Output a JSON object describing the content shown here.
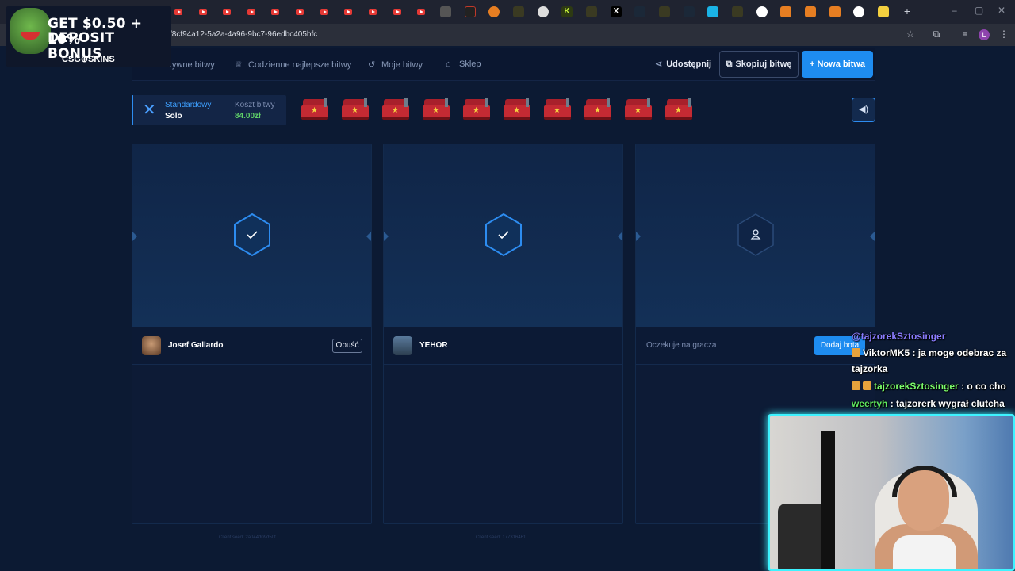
{
  "browser": {
    "url": "/8cf94a12-5a2a-4a96-9bc7-96edbc405bfc",
    "profile_initial": "L"
  },
  "ad": {
    "line1": "GET $0.50 + 10%",
    "line2": "DEPOSIT BONUS",
    "brand": "CSG⊕SKINS"
  },
  "nav": {
    "active_battles": "Aktywne bitwy",
    "daily_best": "Codzienne najlepsze bitwy",
    "my_battles": "Moje bitwy",
    "shop": "Sklep",
    "share": "Udostępnij",
    "copy_battle": "Skopiuj bitwę",
    "new_battle": "+ Nowa bitwa"
  },
  "battle": {
    "mode_label": "Standardowy",
    "mode_value": "Solo",
    "cost_label": "Koszt bitwy",
    "cost_value": "84.00zł",
    "case_count": 10
  },
  "slots": [
    {
      "player": "Josef Gallardo",
      "action": "Opuść",
      "seed": "Client seed: 2a044d09d50f"
    },
    {
      "player": "YEHOR",
      "seed": "Client seed: 177316461"
    },
    {
      "waiting": "Oczekuje na gracza",
      "action": "Dodaj bota"
    }
  ],
  "chat": [
    {
      "user": "@tajzorekSztosinger",
      "user_color": "#8a7cff",
      "text": ""
    },
    {
      "user": "ViktorMK5",
      "user_color": "#ffffff",
      "text": " : ja moge odebrac za"
    },
    {
      "user": "",
      "user_color": "#ffffff",
      "text": "tajzorka"
    },
    {
      "user": "tajzorekSztosinger",
      "user_color": "#7cff6b",
      "text": " : o co cho"
    },
    {
      "user": "weertyh",
      "user_color": "#5ee85e",
      "text": " : tajzorerk wygrał clutcha"
    }
  ],
  "colors": {
    "accent": "#1e8cf0",
    "background": "#0c1a33",
    "cost_green": "#5fd068",
    "webcam_border": "#3ef3ff"
  }
}
